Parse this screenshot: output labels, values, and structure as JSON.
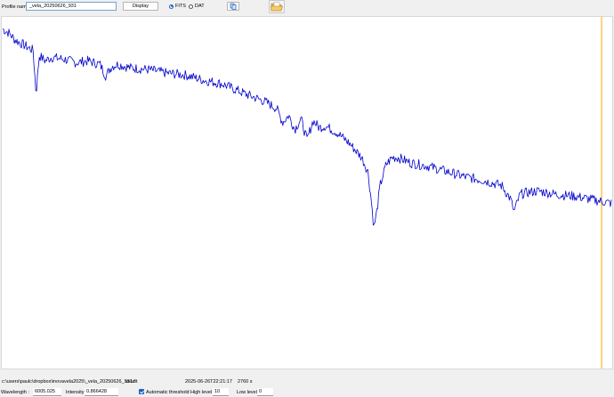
{
  "toolbar": {
    "profile_label": "Profile name :",
    "profile_value": "_vela_20250626_931",
    "display_label": "Display",
    "format_options": [
      {
        "label": "FITS",
        "selected": true
      },
      {
        "label": "DAT",
        "selected": false
      }
    ],
    "icons": {
      "copy": "copy-icon",
      "folder": "folder-open-icon"
    }
  },
  "chart_data": {
    "type": "line",
    "title": "",
    "xlabel": "",
    "ylabel": "",
    "grid": false,
    "legend": "none",
    "colors": {
      "series": "#0000cc",
      "marker": "#ffa500"
    },
    "series": [
      {
        "color": "#0000cc",
        "x": [
          0.0,
          0.01,
          0.02,
          0.03,
          0.04,
          0.05,
          0.055,
          0.06,
          0.07,
          0.08,
          0.1,
          0.12,
          0.14,
          0.16,
          0.17,
          0.175,
          0.18,
          0.19,
          0.21,
          0.24,
          0.27,
          0.3,
          0.33,
          0.36,
          0.4,
          0.43,
          0.45,
          0.46,
          0.47,
          0.48,
          0.49,
          0.5,
          0.51,
          0.52,
          0.53,
          0.55,
          0.57,
          0.58,
          0.59,
          0.6,
          0.605,
          0.61,
          0.615,
          0.62,
          0.63,
          0.64,
          0.65,
          0.67,
          0.7,
          0.73,
          0.76,
          0.79,
          0.82,
          0.835,
          0.84,
          0.845,
          0.85,
          0.86,
          0.88,
          0.91,
          0.94,
          0.97,
          1.0
        ],
        "y": [
          0.965,
          0.955,
          0.935,
          0.925,
          0.915,
          0.905,
          0.78,
          0.89,
          0.875,
          0.885,
          0.88,
          0.87,
          0.875,
          0.865,
          0.83,
          0.85,
          0.86,
          0.865,
          0.855,
          0.85,
          0.84,
          0.835,
          0.82,
          0.81,
          0.78,
          0.76,
          0.74,
          0.7,
          0.72,
          0.68,
          0.71,
          0.65,
          0.705,
          0.685,
          0.69,
          0.67,
          0.64,
          0.62,
          0.6,
          0.56,
          0.49,
          0.4,
          0.45,
          0.52,
          0.58,
          0.6,
          0.6,
          0.585,
          0.575,
          0.56,
          0.545,
          0.535,
          0.52,
          0.48,
          0.445,
          0.47,
          0.495,
          0.5,
          0.505,
          0.495,
          0.49,
          0.48,
          0.47
        ]
      }
    ],
    "xlim": [
      0,
      1
    ],
    "ylim": [
      0,
      1
    ],
    "vertical_marker_x": 0.984
  },
  "info": {
    "path": "c:\\users\\paulc\\dropbox\\inovavela2025\\_vela_20250626_931.fit",
    "object": "vela",
    "datetime": "2025-06-26T22:21:17",
    "exposure": "2760 s"
  },
  "controls": {
    "wavelength_label": "Wavelength :",
    "wavelength_value": "6005.025",
    "intensity_label": "Intensity :",
    "intensity_value": "0.866428",
    "auto_threshold_label": "Automatic threshold",
    "auto_threshold_checked": true,
    "high_level_label": "High level :",
    "high_level_value": "10",
    "low_level_label": "Low level :",
    "low_level_value": "0"
  }
}
